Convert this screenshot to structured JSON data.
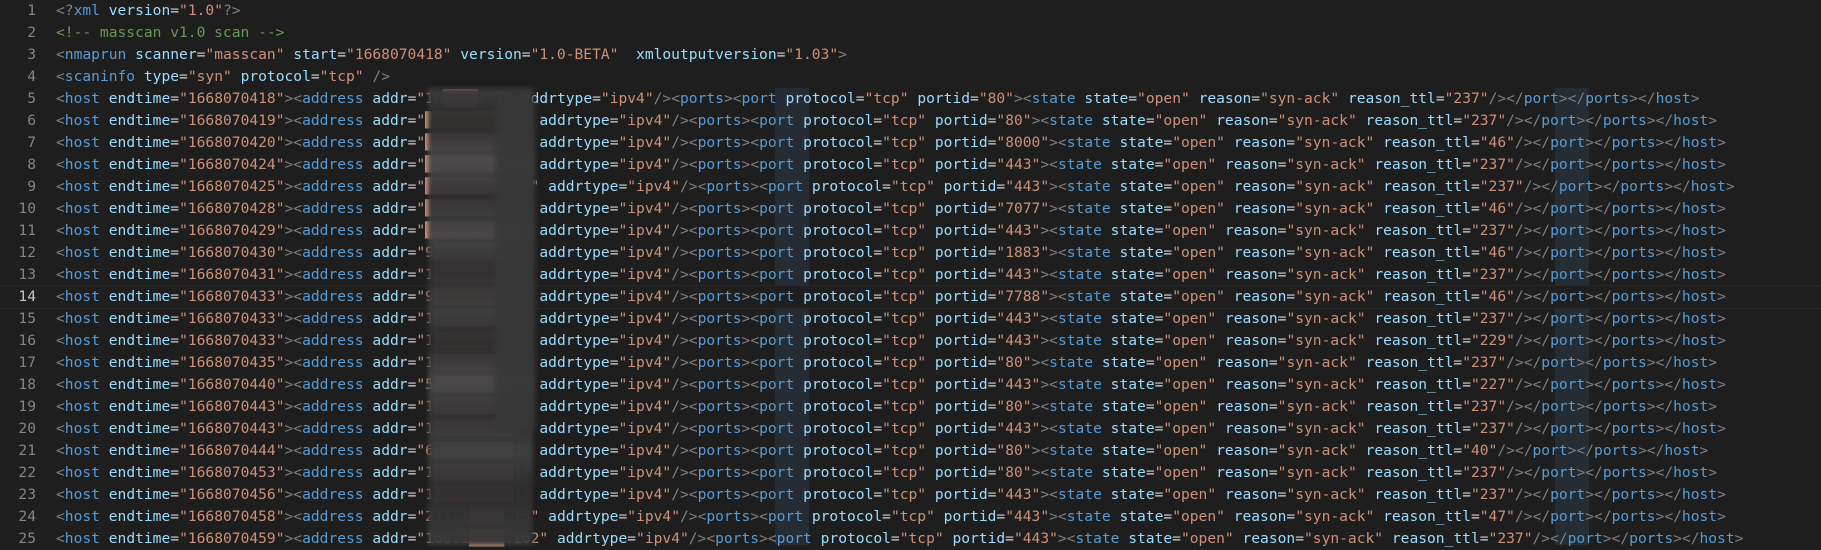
{
  "editor": {
    "lines": [
      {
        "number": "1",
        "text": "<?xml version=\"1.0\"?>"
      },
      {
        "number": "2",
        "text": "<!-- masscan v1.0 scan -->"
      },
      {
        "number": "3",
        "text": "<nmaprun scanner=\"masscan\" start=\"1668070418\" version=\"1.0-BETA\"  xmloutputversion=\"1.03\">"
      },
      {
        "number": "4",
        "text": "<scaninfo type=\"syn\" protocol=\"tcp\" />"
      },
      {
        "number": "5",
        "text": "<host endtime=\"1668070418\"><address addr=\"16████203\" addrtype=\"ipv4\"/><ports><port protocol=\"tcp\" portid=\"80\"><state state=\"open\" reason=\"syn-ack\" reason_ttl=\"237\"/></port></ports></host>"
      },
      {
        "number": "6",
        "text": "<host endtime=\"1668070419\"><address addr=\"█████████55\" addrtype=\"ipv4\"/><ports><port protocol=\"tcp\" portid=\"80\"><state state=\"open\" reason=\"syn-ack\" reason_ttl=\"237\"/></port></ports></host>"
      },
      {
        "number": "7",
        "text": "<host endtime=\"1668070420\"><address addr=\"█████████65\" addrtype=\"ipv4\"/><ports><port protocol=\"tcp\" portid=\"8000\"><state state=\"open\" reason=\"syn-ack\" reason_ttl=\"46\"/></port></ports></host>"
      },
      {
        "number": "8",
        "text": "<host endtime=\"1668070424\"><address addr=\"███████████\" addrtype=\"ipv4\"/><ports><port protocol=\"tcp\" portid=\"443\"><state state=\"open\" reason=\"syn-ack\" reason_ttl=\"237\"/></port></ports></host>"
      },
      {
        "number": "9",
        "text": "<host endtime=\"1668070425\"><address addr=\"███████████7\" addrtype=\"ipv4\"/><ports><port protocol=\"tcp\" portid=\"443\"><state state=\"open\" reason=\"syn-ack\" reason_ttl=\"237\"/></port></ports></host>"
      },
      {
        "number": "10",
        "text": "<host endtime=\"1668070428\"><address addr=\"███████████\" addrtype=\"ipv4\"/><ports><port protocol=\"tcp\" portid=\"7077\"><state state=\"open\" reason=\"syn-ack\" reason_ttl=\"46\"/></port></ports></host>"
      },
      {
        "number": "11",
        "text": "<host endtime=\"1668070429\"><address addr=\"███████████\" addrtype=\"ipv4\"/><ports><port protocol=\"tcp\" portid=\"443\"><state state=\"open\" reason=\"syn-ack\" reason_ttl=\"237\"/></port></ports></host>"
      },
      {
        "number": "12",
        "text": "<host endtime=\"1668070430\"><address addr=\"9██████████\" addrtype=\"ipv4\"/><ports><port protocol=\"tcp\" portid=\"1883\"><state state=\"open\" reason=\"syn-ack\" reason_ttl=\"46\"/></port></ports></host>"
      },
      {
        "number": "13",
        "text": "<host endtime=\"1668070431\"><address addr=\"1██████████\" addrtype=\"ipv4\"/><ports><port protocol=\"tcp\" portid=\"443\"><state state=\"open\" reason=\"syn-ack\" reason_ttl=\"237\"/></port></ports></host>"
      },
      {
        "number": "14",
        "text": "<host endtime=\"1668070433\"><address addr=\"9██████████\" addrtype=\"ipv4\"/><ports><port protocol=\"tcp\" portid=\"7788\"><state state=\"open\" reason=\"syn-ack\" reason_ttl=\"46\"/></port></ports></host>"
      },
      {
        "number": "15",
        "text": "<host endtime=\"1668070433\"><address addr=\"1██████████\" addrtype=\"ipv4\"/><ports><port protocol=\"tcp\" portid=\"443\"><state state=\"open\" reason=\"syn-ack\" reason_ttl=\"237\"/></port></ports></host>"
      },
      {
        "number": "16",
        "text": "<host endtime=\"1668070433\"><address addr=\"1█████████7\" addrtype=\"ipv4\"/><ports><port protocol=\"tcp\" portid=\"443\"><state state=\"open\" reason=\"syn-ack\" reason_ttl=\"229\"/></port></ports></host>"
      },
      {
        "number": "17",
        "text": "<host endtime=\"1668070435\"><address addr=\"1█████████2\" addrtype=\"ipv4\"/><ports><port protocol=\"tcp\" portid=\"80\"><state state=\"open\" reason=\"syn-ack\" reason_ttl=\"237\"/></port></ports></host>"
      },
      {
        "number": "18",
        "text": "<host endtime=\"1668070440\"><address addr=\"5█████████2\" addrtype=\"ipv4\"/><ports><port protocol=\"tcp\" portid=\"443\"><state state=\"open\" reason=\"syn-ack\" reason_ttl=\"227\"/></port></ports></host>"
      },
      {
        "number": "19",
        "text": "<host endtime=\"1668070443\"><address addr=\"1█████████0\" addrtype=\"ipv4\"/><ports><port protocol=\"tcp\" portid=\"80\"><state state=\"open\" reason=\"syn-ack\" reason_ttl=\"237\"/></port></ports></host>"
      },
      {
        "number": "20",
        "text": "<host endtime=\"1668070443\"><address addr=\"1█████████7\" addrtype=\"ipv4\"/><ports><port protocol=\"tcp\" portid=\"443\"><state state=\"open\" reason=\"syn-ack\" reason_ttl=\"237\"/></port></ports></host>"
      },
      {
        "number": "21",
        "text": "<host endtime=\"1668070444\"><address addr=\"6█████████2\" addrtype=\"ipv4\"/><ports><port protocol=\"tcp\" portid=\"80\"><state state=\"open\" reason=\"syn-ack\" reason_ttl=\"40\"/></port></ports></host>"
      },
      {
        "number": "22",
        "text": "<host endtime=\"1668070453\"><address addr=\"1█████████1\" addrtype=\"ipv4\"/><ports><port protocol=\"tcp\" portid=\"80\"><state state=\"open\" reason=\"syn-ack\" reason_ttl=\"237\"/></port></ports></host>"
      },
      {
        "number": "23",
        "text": "<host endtime=\"1668070456\"><address addr=\"1█████████1\" addrtype=\"ipv4\"/><ports><port protocol=\"tcp\" portid=\"443\"><state state=\"open\" reason=\"syn-ack\" reason_ttl=\"237\"/></port></ports></host>"
      },
      {
        "number": "24",
        "text": "<host endtime=\"1668070458\"><address addr=\"211.2████.15\" addrtype=\"ipv4\"/><ports><port protocol=\"tcp\" portid=\"443\"><state state=\"open\" reason=\"syn-ack\" reason_ttl=\"47\"/></port></ports></host>"
      },
      {
        "number": "25",
        "text": "<host endtime=\"1668070459\"><address addr=\"160.1████.162\" addrtype=\"ipv4\"/><ports><port protocol=\"tcp\" portid=\"443\"><state state=\"open\" reason=\"syn-ack\" reason_ttl=\"237\"/></port></ports></host>"
      }
    ],
    "current_line": "14",
    "colors": {
      "background": "#1e1e1e",
      "line_number": "#858585",
      "tag": "#569cd6",
      "attribute": "#9cdcfe",
      "string": "#ce9178",
      "comment": "#6a9955",
      "punctuation": "#808080"
    }
  }
}
